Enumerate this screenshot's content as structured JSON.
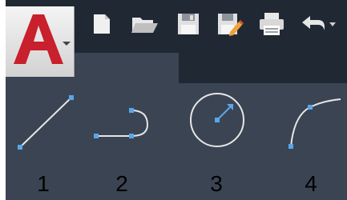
{
  "app": {
    "logo_letter": "A",
    "logo_color": "#c8202c"
  },
  "quick_access": [
    {
      "icon": "new-file-icon"
    },
    {
      "icon": "open-folder-icon"
    },
    {
      "icon": "save-icon"
    },
    {
      "icon": "save-as-icon"
    },
    {
      "icon": "print-icon"
    },
    {
      "icon": "undo-icon"
    }
  ],
  "colors": {
    "window_bg": "#3b4453",
    "titlebar_bg": "#202834",
    "grip_color": "#5aa6e8",
    "line_color": "#e6e6e6"
  },
  "tools": [
    {
      "name": "line",
      "number": "1"
    },
    {
      "name": "polyline",
      "number": "2"
    },
    {
      "name": "circle",
      "number": "3"
    },
    {
      "name": "arc",
      "number": "4"
    }
  ]
}
